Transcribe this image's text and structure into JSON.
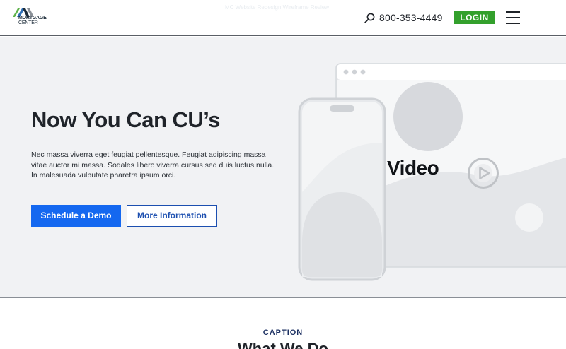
{
  "header": {
    "logo_line1": "MORTGAGE",
    "logo_line2": "CENTER",
    "banner_text": "MC Website Redesign Wireframe Review",
    "phone": "800-353-4449",
    "login_label": "LOGIN",
    "icons": {
      "phone": "search-icon",
      "menu": "hamburger-menu-icon"
    }
  },
  "hero": {
    "title": "Now You Can CU’s",
    "body": "Nec massa viverra eget feugiat pellentesque. Feugiat adipiscing massa vitae auctor mi massa. Sodales libero viverra cursus sed duis luctus nulla. In malesuada vulputate pharetra ipsum orci.",
    "primary_button": "Schedule a Demo",
    "secondary_button": "More Information",
    "video_label": "Video",
    "icons": {
      "play": "play-icon"
    }
  },
  "section": {
    "caption": "CAPTION",
    "title": "What We Do"
  },
  "colors": {
    "login_green": "#33a02c",
    "primary_blue": "#1468f0",
    "secondary_blue": "#1c4fb0",
    "hero_bg": "#f1f2f4",
    "caption_navy": "#1c3062"
  }
}
